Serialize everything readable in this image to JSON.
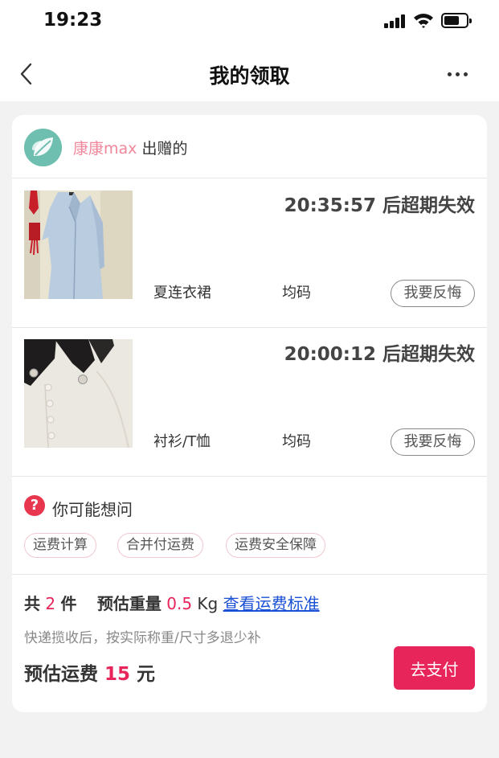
{
  "status_bar": {
    "time": "19:23"
  },
  "nav": {
    "title": "我的领取"
  },
  "donor": {
    "name": "康康max",
    "suffix": " 出赠的"
  },
  "items": [
    {
      "countdown": "20:35:57 后超期失效",
      "name": "夏连衣裙",
      "size": "均码",
      "regret_label": "我要反悔"
    },
    {
      "countdown": "20:00:12 后超期失效",
      "name": "衬衫/T恤",
      "size": "均码",
      "regret_label": "我要反悔"
    }
  ],
  "faq": {
    "title": "你可能想问",
    "icon": "?",
    "tags": [
      "运费计算",
      "合并付运费",
      "运费安全保障"
    ]
  },
  "summary": {
    "total_prefix": "共",
    "total_count": "2",
    "total_unit": "件",
    "weight_label": "预估重量",
    "weight_value": "0.5",
    "weight_unit": "Kg",
    "fee_standard_link": "查看运费标准",
    "note": "快递揽收后，按实际称重/尺寸多退少补",
    "fee_label": "预估运费",
    "fee_value": "15",
    "fee_unit": "元",
    "pay_label": "去支付"
  },
  "colors": {
    "accent": "#e8255a",
    "donor_name": "#f0879a",
    "link": "#1a4fd6"
  }
}
